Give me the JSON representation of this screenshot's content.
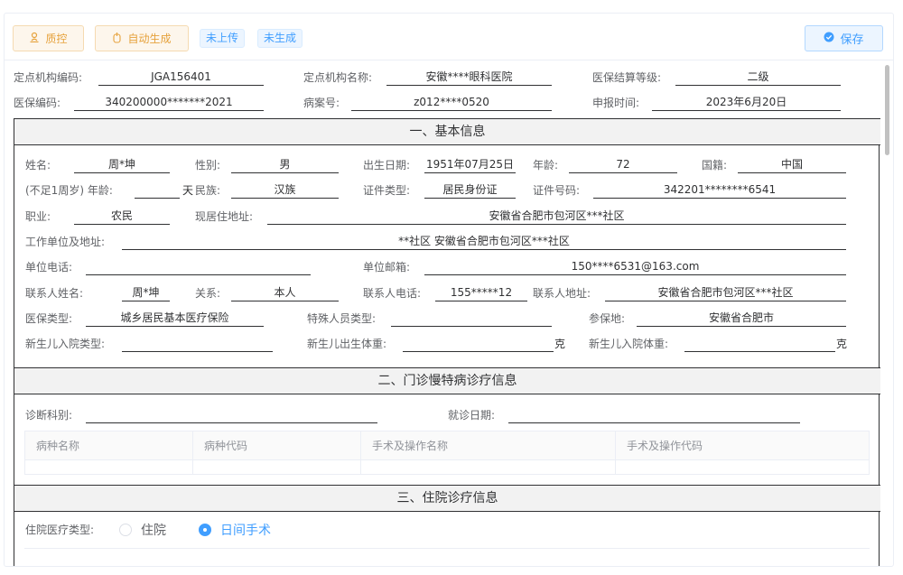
{
  "toolbar": {
    "qc_label": "质控",
    "auto_label": "自动生成",
    "tag_upload": "未上传",
    "tag_generate": "未生成",
    "save_label": "保存"
  },
  "header": {
    "org_code_label": "定点机构编码:",
    "org_code": "JGA156401",
    "org_name_label": "定点机构名称:",
    "org_name": "安徽****眼科医院",
    "settle_level_label": "医保结算等级:",
    "settle_level": "二级",
    "insurance_code_label": "医保编码:",
    "insurance_code": "340200000*******2021",
    "case_no_label": "病案号:",
    "case_no": "z012****0520",
    "report_time_label": "申报时间:",
    "report_time": "2023年6月20日"
  },
  "sections": {
    "basic": "一、基本信息",
    "outpatient": "二、门诊慢特病诊疗信息",
    "inpatient": "三、住院诊疗信息"
  },
  "basic": {
    "name_label": "姓名:",
    "name": "周*坤",
    "sex_label": "性别:",
    "sex": "男",
    "birth_label": "出生日期:",
    "birth": "1951年07月25日",
    "age_label": "年龄:",
    "age": "72",
    "nation_label": "国籍:",
    "nation": "中国",
    "infant_age_label": "(不足1周岁) 年龄:",
    "infant_age_unit": "天",
    "ethnic_label": "民族:",
    "ethnic": "汉族",
    "id_type_label": "证件类型:",
    "id_type": "居民身份证",
    "id_no_label": "证件号码:",
    "id_no": "342201********6541",
    "job_label": "职业:",
    "job": "农民",
    "address_label": "现居住地址:",
    "address": "安徽省合肥市包河区***社区",
    "work_label": "工作单位及地址:",
    "work": "**社区 安徽省合肥市包河区***社区",
    "work_phone_label": "单位电话:",
    "work_phone": "",
    "work_email_label": "单位邮箱:",
    "work_email": "150****6531@163.com",
    "contact_name_label": "联系人姓名:",
    "contact_name": "周*坤",
    "relation_label": "关系:",
    "relation": "本人",
    "contact_phone_label": "联系人电话:",
    "contact_phone": "155*****12",
    "contact_addr_label": "联系人地址:",
    "contact_addr": "安徽省合肥市包河区***社区",
    "ins_type_label": "医保类型:",
    "ins_type": "城乡居民基本医疗保险",
    "special_label": "特殊人员类型:",
    "special": "",
    "ins_place_label": "参保地:",
    "ins_place": "安徽省合肥市",
    "newborn_type_label": "新生儿入院类型:",
    "newborn_type": "",
    "newborn_birth_wt_label": "新生儿出生体重:",
    "newborn_birth_wt": "",
    "newborn_adm_wt_label": "新生儿入院体重:",
    "newborn_adm_wt": "",
    "weight_unit": "克"
  },
  "outpatient": {
    "dept_label": "诊断科别:",
    "dept": "",
    "visit_date_label": "就诊日期:",
    "visit_date": "",
    "columns": [
      "病种名称",
      "病种代码",
      "手术及操作名称",
      "手术及操作代码"
    ]
  },
  "inpatient": {
    "type_label": "住院医疗类型:",
    "options": [
      "住院",
      "日间手术"
    ],
    "selected": "日间手术"
  }
}
